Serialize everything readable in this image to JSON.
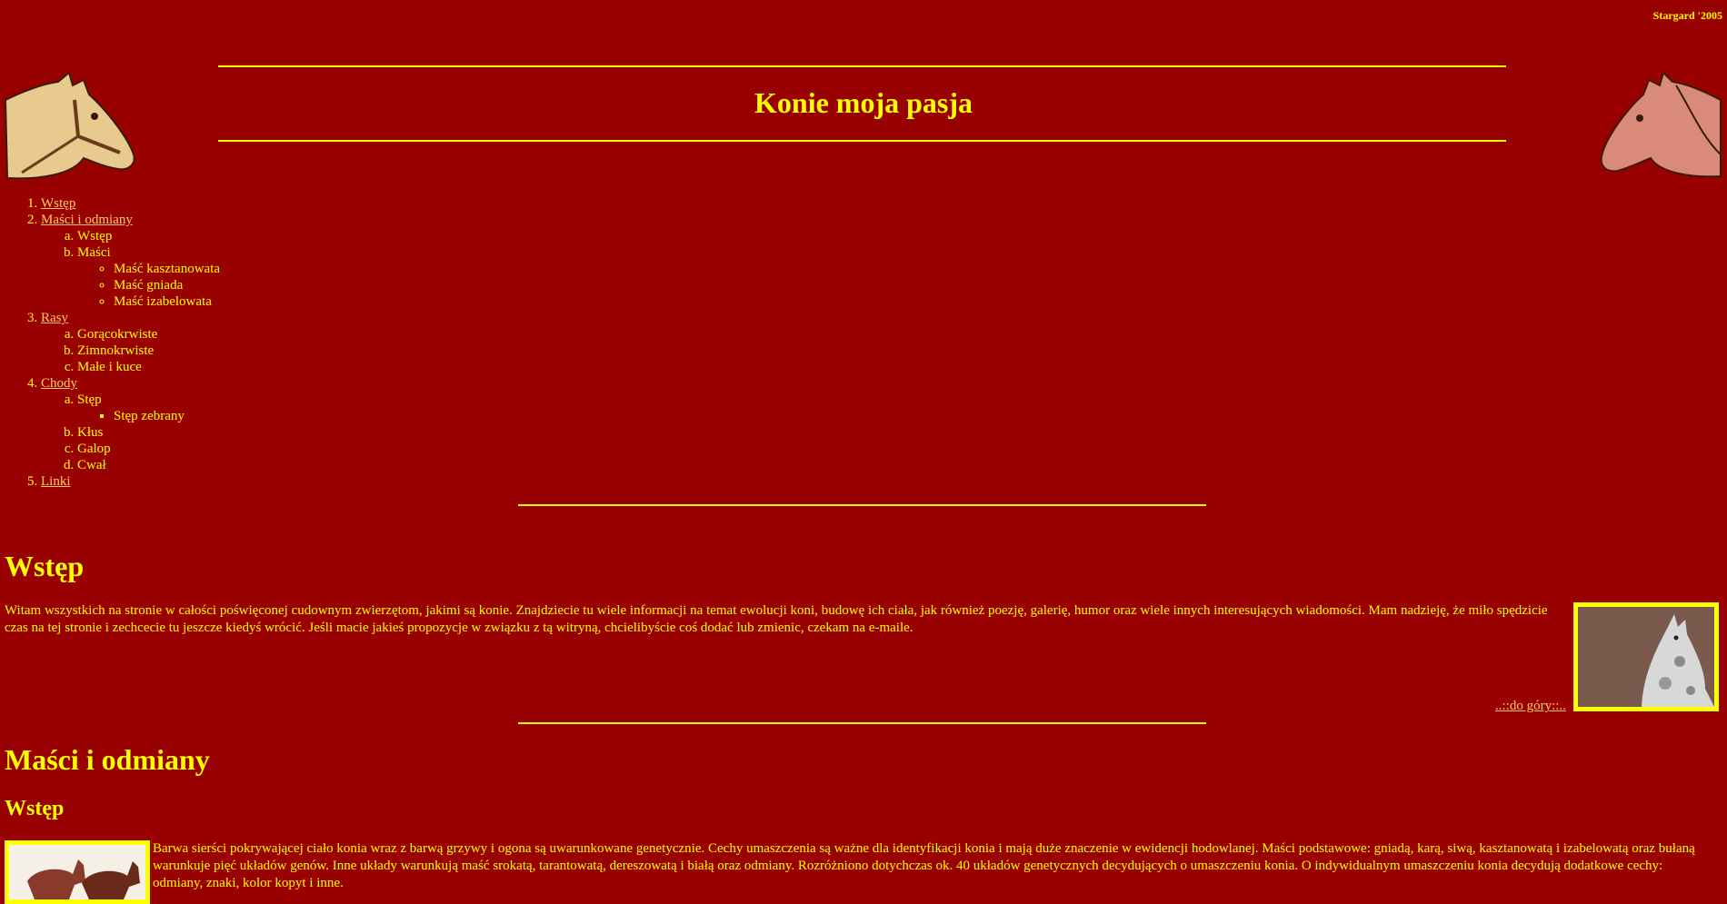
{
  "header": {
    "stamp": "Stargard '2005",
    "title": "Konie moja pasja"
  },
  "toc": [
    {
      "label": "Wstęp"
    },
    {
      "label": "Maści i odmiany",
      "sub": [
        {
          "label": "Wstęp"
        },
        {
          "label": "Maści",
          "sub": [
            "Maść kasztanowata",
            "Maść gniada",
            "Maść izabelowata"
          ]
        }
      ]
    },
    {
      "label": "Rasy",
      "sub": [
        {
          "label": "Gorącokrwiste"
        },
        {
          "label": "Zimnokrwiste"
        },
        {
          "label": "Małe i kuce"
        }
      ]
    },
    {
      "label": "Chody",
      "sub": [
        {
          "label": "Stęp",
          "sub": [
            "Stęp zebrany"
          ]
        },
        {
          "label": "Kłus"
        },
        {
          "label": "Galop"
        },
        {
          "label": "Cwał"
        }
      ]
    },
    {
      "label": "Linki"
    }
  ],
  "intro": {
    "heading": "Wstęp",
    "text": "Witam wszystkich na stronie w całości poświęconej cudownym zwierzętom, jakimi są konie. Znajdziecie tu wiele informacji na temat ewolucji koni, budowę ich ciała, jak również poezję, galerię, humor oraz wiele innych interesujących wiadomości. Mam nadzieję, że miło spędzicie czas na tej stronie i zechcecie tu jeszcze kiedyś wrócić. Jeśli macie jakieś propozycje w związku z tą witryną, chcielibyście coś dodać lub zmienic, czekam na e-maile.",
    "up_link": "..::do góry::.."
  },
  "colors_section": {
    "heading": "Maści i odmiany",
    "subheading": "Wstęp",
    "text": "Barwa sierści pokrywającej ciało konia wraz z barwą grzywy i ogona są uwarunkowane genetycznie. Cechy umaszczenia są ważne dla identyfikacji konia i mają duże znaczenie w ewidencji hodowlanej. Maści podstawowe: gniadą, karą, siwą, kasztanowatą i izabelowatą oraz bułaną warunkuje pięć układów genów. Inne układy warunkują maść srokatą, tarantowatą, dereszowatą i białą oraz odmiany. Rozróżniono dotychczas ok. 40 układów genetycznych decydujących o umaszczeniu konia. O indywidualnym umaszczeniu konia decydują dodatkowe cechy: odmiany, znaki, kolor kopyt i inne."
  },
  "colors": {
    "background": "#990000",
    "text": "#ffff00",
    "link": "#ffcc66"
  }
}
